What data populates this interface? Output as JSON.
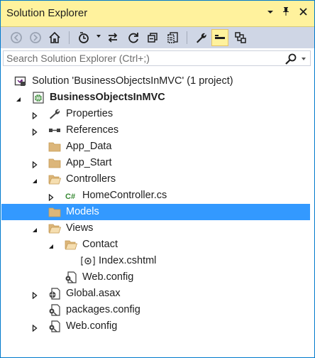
{
  "window": {
    "title": "Solution Explorer"
  },
  "search": {
    "placeholder": "Search Solution Explorer (Ctrl+;)"
  },
  "tree": {
    "items": [
      {
        "label": "Solution 'BusinessObjectsInMVC' (1 project)",
        "icon": "solution-icon",
        "bold": false,
        "expander": "none",
        "depth": 0
      },
      {
        "label": "BusinessObjectsInMVC",
        "icon": "web-project-icon",
        "bold": true,
        "expander": "expanded",
        "depth": 1
      },
      {
        "label": "Properties",
        "icon": "wrench-icon",
        "bold": false,
        "expander": "collapsed",
        "depth": 2
      },
      {
        "label": "References",
        "icon": "references-icon",
        "bold": false,
        "expander": "collapsed",
        "depth": 2
      },
      {
        "label": "App_Data",
        "icon": "folder-icon",
        "bold": false,
        "expander": "none",
        "depth": 2
      },
      {
        "label": "App_Start",
        "icon": "folder-icon",
        "bold": false,
        "expander": "collapsed",
        "depth": 2
      },
      {
        "label": "Controllers",
        "icon": "folder-open-icon",
        "bold": false,
        "expander": "expanded",
        "depth": 2
      },
      {
        "label": "HomeController.cs",
        "icon": "csharp-file-icon",
        "bold": false,
        "expander": "collapsed",
        "depth": 3
      },
      {
        "label": "Models",
        "icon": "folder-icon",
        "bold": false,
        "expander": "none",
        "depth": 2,
        "selected": true
      },
      {
        "label": "Views",
        "icon": "folder-open-icon",
        "bold": false,
        "expander": "expanded",
        "depth": 2
      },
      {
        "label": "Contact",
        "icon": "folder-open-icon",
        "bold": false,
        "expander": "expanded",
        "depth": 3
      },
      {
        "label": "Index.cshtml",
        "icon": "razor-file-icon",
        "bold": false,
        "expander": "none",
        "depth": 4
      },
      {
        "label": "Web.config",
        "icon": "config-file-icon",
        "bold": false,
        "expander": "none",
        "depth": 3
      },
      {
        "label": "Global.asax",
        "icon": "global-asax-icon",
        "bold": false,
        "expander": "collapsed",
        "depth": 2
      },
      {
        "label": "packages.config",
        "icon": "config-file-icon",
        "bold": false,
        "expander": "none",
        "depth": 2
      },
      {
        "label": "Web.config",
        "icon": "config-file-icon",
        "bold": false,
        "expander": "collapsed",
        "depth": 2
      }
    ]
  },
  "colors": {
    "title_bar": "#fff29d",
    "toolbar": "#cfd6e5",
    "selection": "#3399ff",
    "border": "#007acc",
    "folder": "#dcb67a"
  }
}
